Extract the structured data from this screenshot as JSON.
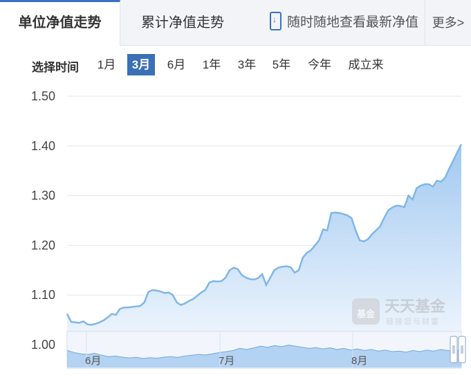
{
  "tabs": {
    "unit_nav": "单位净值走势",
    "cumulative_nav": "累计净值走势",
    "mobile_promo": "随时随地查看最新净值",
    "more": "更多>"
  },
  "period_selector": {
    "label": "选择时间",
    "options": [
      "1月",
      "3月",
      "6月",
      "1年",
      "3年",
      "5年",
      "今年",
      "成立来"
    ],
    "selected": "3月"
  },
  "colors": {
    "accent": "#3b6fb6",
    "line": "#7fb6e8",
    "area_top": "#9cc6f0",
    "area_bottom": "#eef5fd"
  },
  "watermark": {
    "logo_text": "基金",
    "name": "天天基金",
    "slogan": "链接您与财富"
  },
  "chart_data": {
    "type": "area",
    "title": "",
    "xlabel": "",
    "ylabel": "",
    "ylim": [
      1.0,
      1.5
    ],
    "yticks": [
      "1.50",
      "1.40",
      "1.30",
      "1.20",
      "1.10",
      "1.00"
    ],
    "xticks": [
      "6月",
      "7月",
      "8月"
    ],
    "grid": true,
    "legend": "none",
    "series": [
      {
        "values": [
          1.062,
          1.046,
          1.045,
          1.044,
          1.047,
          1.041,
          1.04,
          1.042,
          1.045,
          1.049,
          1.055,
          1.062,
          1.06,
          1.072,
          1.075,
          1.075,
          1.076,
          1.077,
          1.078,
          1.085,
          1.106,
          1.11,
          1.109,
          1.107,
          1.104,
          1.105,
          1.1,
          1.085,
          1.08,
          1.083,
          1.088,
          1.092,
          1.098,
          1.105,
          1.11,
          1.125,
          1.128,
          1.127,
          1.128,
          1.135,
          1.15,
          1.155,
          1.152,
          1.14,
          1.135,
          1.132,
          1.131,
          1.134,
          1.142,
          1.12,
          1.135,
          1.15,
          1.155,
          1.157,
          1.158,
          1.156,
          1.145,
          1.15,
          1.175,
          1.185,
          1.19,
          1.2,
          1.21,
          1.232,
          1.23,
          1.265,
          1.266,
          1.265,
          1.263,
          1.26,
          1.255,
          1.23,
          1.21,
          1.208,
          1.212,
          1.222,
          1.23,
          1.238,
          1.255,
          1.27,
          1.276,
          1.28,
          1.279,
          1.277,
          1.3,
          1.292,
          1.315,
          1.32,
          1.323,
          1.323,
          1.318,
          1.33,
          1.328,
          1.336,
          1.354,
          1.37,
          1.387,
          1.403
        ]
      }
    ]
  }
}
